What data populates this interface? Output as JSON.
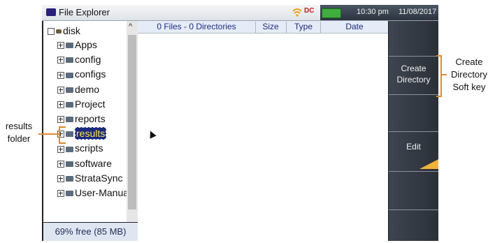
{
  "app": {
    "title": "File Explorer"
  },
  "status": {
    "time": "10:30 pm",
    "date": "11/08/2017",
    "dc_label": "DC"
  },
  "tree": {
    "root": "disk",
    "items": [
      "Apps",
      "config",
      "configs",
      "demo",
      "Project",
      "reports",
      "results",
      "scripts",
      "software",
      "StrataSync",
      "User-Manua"
    ],
    "selected": "results"
  },
  "free_space": "69% free (85 MB)",
  "list": {
    "columns": [
      "0 Files - 0 Directories",
      "Size",
      "Type",
      "Date"
    ]
  },
  "softkeys": {
    "create": "Create Directory",
    "edit": "Edit"
  },
  "annotations": {
    "left": "results folder",
    "right": "Create Directory Soft key"
  },
  "colors": {
    "accent": "#e28a2d",
    "selected_bg": "#1b2a80",
    "selected_text": "#ffe84a"
  }
}
